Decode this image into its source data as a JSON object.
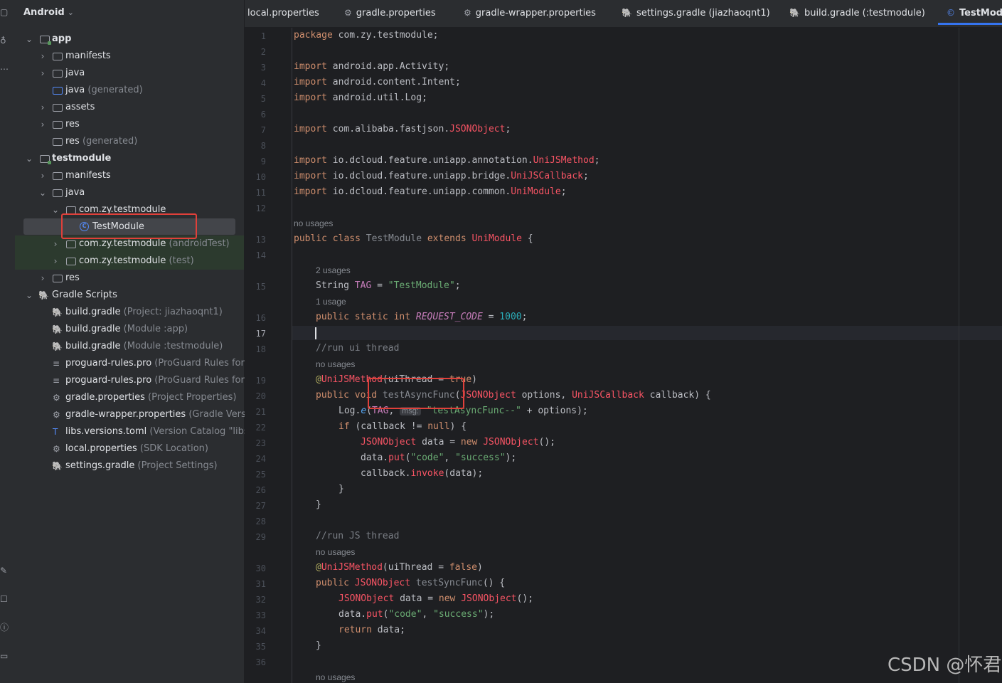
{
  "project_panel": {
    "view_selector": "Android",
    "tree": [
      {
        "label": "app",
        "hint": "",
        "bold": true
      },
      {
        "label": "manifests",
        "hint": ""
      },
      {
        "label": "java",
        "hint": ""
      },
      {
        "label": "java",
        "hint": "(generated)"
      },
      {
        "label": "assets",
        "hint": ""
      },
      {
        "label": "res",
        "hint": ""
      },
      {
        "label": "res",
        "hint": "(generated)"
      },
      {
        "label": "testmodule",
        "hint": "",
        "bold": true
      },
      {
        "label": "manifests",
        "hint": ""
      },
      {
        "label": "java",
        "hint": ""
      },
      {
        "label": "com.zy.testmodule",
        "hint": ""
      },
      {
        "label": "TestModule",
        "hint": ""
      },
      {
        "label": "com.zy.testmodule",
        "hint": "(androidTest)"
      },
      {
        "label": "com.zy.testmodule",
        "hint": "(test)"
      },
      {
        "label": "res",
        "hint": ""
      },
      {
        "label": "Gradle Scripts",
        "hint": ""
      },
      {
        "label": "build.gradle",
        "hint": "(Project: jiazhaoqnt1)"
      },
      {
        "label": "build.gradle",
        "hint": "(Module :app)"
      },
      {
        "label": "build.gradle",
        "hint": "(Module :testmodule)"
      },
      {
        "label": "proguard-rules.pro",
        "hint": "(ProGuard Rules for \":"
      },
      {
        "label": "proguard-rules.pro",
        "hint": "(ProGuard Rules for \":"
      },
      {
        "label": "gradle.properties",
        "hint": "(Project Properties)"
      },
      {
        "label": "gradle-wrapper.properties",
        "hint": "(Gradle Versio"
      },
      {
        "label": "libs.versions.toml",
        "hint": "(Version Catalog \"libs\")"
      },
      {
        "label": "local.properties",
        "hint": "(SDK Location)"
      },
      {
        "label": "settings.gradle",
        "hint": "(Project Settings)"
      }
    ]
  },
  "tabs": [
    {
      "label": "local.properties"
    },
    {
      "label": "gradle.properties"
    },
    {
      "label": "gradle-wrapper.properties"
    },
    {
      "label": "settings.gradle (jiazhaoqnt1)"
    },
    {
      "label": "build.gradle (:testmodule)"
    },
    {
      "label": "TestModu"
    }
  ],
  "editor": {
    "current_line": "17",
    "line_numbers": [
      "1",
      "2",
      "3",
      "4",
      "5",
      "6",
      "7",
      "8",
      "9",
      "10",
      "11",
      "12",
      "13",
      "14",
      "15",
      "16",
      "17",
      "18",
      "19",
      "20",
      "21",
      "22",
      "23",
      "24",
      "25",
      "26",
      "27",
      "28",
      "29",
      "30",
      "31",
      "32",
      "33",
      "34",
      "35",
      "36"
    ],
    "hints": {
      "no_usages": "no usages",
      "two_usages": "2 usages",
      "one_usage": "1 usage"
    },
    "inlay_msg": "msg:",
    "code": {
      "l1_kw": "package",
      "l1_rest": " com.zy.testmodule;",
      "import_kw": "import",
      "l3": " android.app.Activity;",
      "l4": " android.content.Intent;",
      "l5": " android.util.Log;",
      "l7a": " com.alibaba.fastjson.",
      "l7b": "JSONObject",
      "l7c": ";",
      "l9a": " io.dcloud.feature.uniapp.annotation.",
      "l9b": "UniJSMethod",
      "l9c": ";",
      "l10a": " io.dcloud.feature.uniapp.bridge.",
      "l10b": "UniJSCallback",
      "l10c": ";",
      "l11a": " io.dcloud.feature.uniapp.common.",
      "l11b": "UniModule",
      "l11c": ";",
      "l13a": "public class ",
      "l13b": "TestModule",
      "l13c": " extends ",
      "l13d": "UniModule",
      "l13e": " {",
      "l15a": "String ",
      "l15b": "TAG",
      "l15c": " = ",
      "l15d": "\"TestModule\"",
      "l15e": ";",
      "l16a": "public static int ",
      "l16b": "REQUEST_CODE",
      "l16c": " = ",
      "l16d": "1000",
      "l16e": ";",
      "l18": "//run ui thread",
      "l19a": "@",
      "l19b": "UniJSMethod",
      "l19c": "(uiThread = ",
      "l19d": "true",
      "l19e": ")",
      "l20a": "public void ",
      "l20b": "testAsyncFunc",
      "l20c": "(",
      "l20d": "JSONObject",
      "l20e": " options, ",
      "l20f": "UniJSCallback",
      "l20g": " callback) {",
      "l21a": "Log.",
      "l21b": "e",
      "l21c": "(",
      "l21d": "TAG",
      "l21e": ", ",
      "l21f": "\"testAsyncFunc--\"",
      "l21g": " + options);",
      "l22a": "if",
      "l22b": " (callback != ",
      "l22c": "null",
      "l22d": ") {",
      "l23a": "JSONObject",
      "l23b": " data = ",
      "l23c": "new ",
      "l23d": "JSONObject",
      "l23e": "();",
      "l24a": "data.",
      "l24b": "put",
      "l24c": "(",
      "l24d": "\"code\"",
      "l24e": ", ",
      "l24f": "\"success\"",
      "l24g": ");",
      "l25a": "callback.",
      "l25b": "invoke",
      "l25c": "(data);",
      "l26": "}",
      "l27": "}",
      "l29": "//run JS thread",
      "l30a": "@",
      "l30b": "UniJSMethod",
      "l30c": "(uiThread = ",
      "l30d": "false",
      "l30e": ")",
      "l31a": "public ",
      "l31b": "JSONObject",
      "l31c": " testSyncFunc",
      "l31d": "() {",
      "l32a": "JSONObject",
      "l32b": " data = ",
      "l32c": "new ",
      "l32d": "JSONObject",
      "l32e": "();",
      "l33a": "data.",
      "l33b": "put",
      "l33c": "(",
      "l33d": "\"code\"",
      "l33e": ", ",
      "l33f": "\"success\"",
      "l33g": ");",
      "l34a": "return",
      "l34b": " data;",
      "l35": "}"
    }
  },
  "watermark": "CSDN @怀君"
}
